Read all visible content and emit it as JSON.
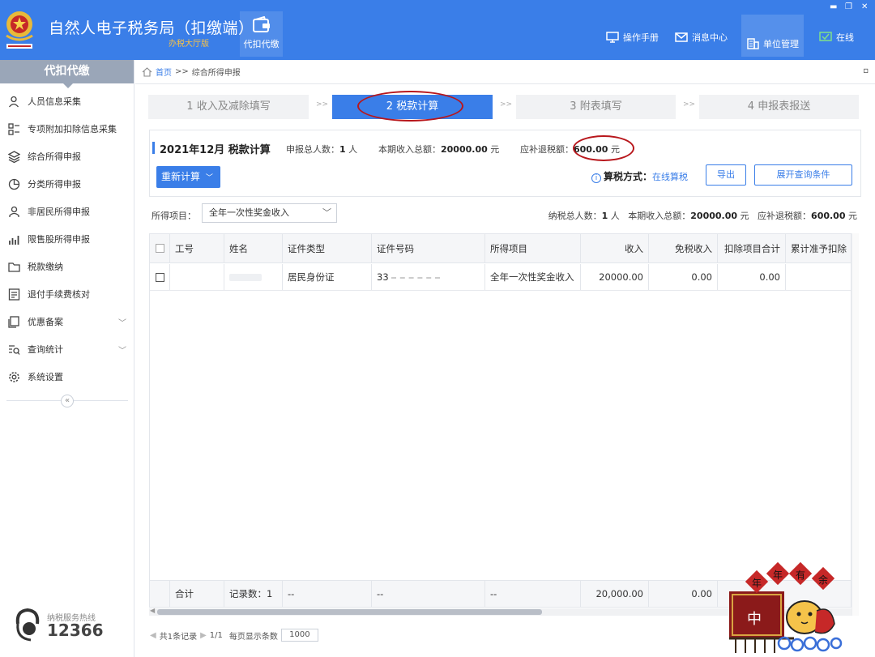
{
  "app": {
    "title": "自然人电子税务局（扣缴端）",
    "subtitle": "办税大厅版",
    "top_tab": "代扣代缴",
    "nav": [
      "操作手册",
      "消息中心",
      "单位管理",
      "在线"
    ],
    "window_controls": [
      "▬",
      "❐",
      "✕"
    ]
  },
  "sidebar": {
    "header": "代扣代缴",
    "items": [
      {
        "label": "人员信息采集",
        "icon": "person-icon"
      },
      {
        "label": "专项附加扣除信息采集",
        "icon": "grid-list-icon"
      },
      {
        "label": "综合所得申报",
        "icon": "layers-icon"
      },
      {
        "label": "分类所得申报",
        "icon": "pie-icon"
      },
      {
        "label": "非居民所得申报",
        "icon": "person-outline-icon"
      },
      {
        "label": "限售股所得申报",
        "icon": "bar-chart-icon"
      },
      {
        "label": "税款缴纳",
        "icon": "folder-icon"
      },
      {
        "label": "退付手续费核对",
        "icon": "list-icon"
      },
      {
        "label": "优惠备案",
        "icon": "copy-icon"
      },
      {
        "label": "查询统计",
        "icon": "search-list-icon"
      },
      {
        "label": "系统设置",
        "icon": "gear-icon"
      }
    ],
    "collapse": "«",
    "hotline_label": "纳税服务热线",
    "hotline_number": "12366"
  },
  "breadcrumb": {
    "home": "首页",
    "sep": ">>",
    "current": "综合所得申报",
    "close": "▫"
  },
  "steps": [
    {
      "label": "1 收入及减除填写"
    },
    {
      "label": "2 税款计算"
    },
    {
      "label": "3 附表填写"
    },
    {
      "label": "4 申报表报送"
    }
  ],
  "step_sep": ">>",
  "panel": {
    "title": "2021年12月 税款计算",
    "total_people_label": "申报总人数：",
    "total_people": "1",
    "people_unit": "人",
    "income_label": "本期收入总额：",
    "income": "20000.00",
    "yuan": "元",
    "tax_label": "应补退税额：",
    "tax": "600.00",
    "recalc": "重新计算",
    "calc_mode_label": "算税方式：",
    "calc_mode": "在线算税",
    "export": "导出",
    "expand_query": "展开查询条件"
  },
  "filter": {
    "label": "所得项目：",
    "value": "全年一次性奖金收入"
  },
  "summary": {
    "people_label": "纳税总人数：",
    "people": "1",
    "people_unit": "人",
    "income_label": "本期收入总额：",
    "income": "20000.00",
    "yuan": "元",
    "tax_label": "应补退税额：",
    "tax": "600.00",
    "yuan2": "元"
  },
  "table": {
    "columns": [
      "工号",
      "姓名",
      "证件类型",
      "证件号码",
      "所得项目",
      "收入",
      "免税收入",
      "扣除项目合计",
      "累计准予扣除"
    ],
    "rows": [
      {
        "id_type": "居民身份证",
        "id_prefix": "33",
        "item": "全年一次性奖金收入",
        "income": "20000.00",
        "tax_free": "0.00",
        "deduct": "0.00"
      }
    ],
    "footer": {
      "label": "合计",
      "records": "记录数：1",
      "dash1": "--",
      "dash2": "--",
      "dash3": "--",
      "income": "20,000.00",
      "tax_free": "0.00"
    }
  },
  "pager": {
    "total": "共1条记录",
    "page": "1/1",
    "per_page_label": "每页显示条数",
    "per_page": "1000"
  },
  "decor": {
    "banner_chars": [
      "年",
      "年",
      "有",
      "余"
    ],
    "lantern_char": "中"
  },
  "colors": {
    "brand_blue": "#3a7ee8",
    "highlight_red": "#b8171c",
    "subtitle_gold": "#f7c247"
  }
}
